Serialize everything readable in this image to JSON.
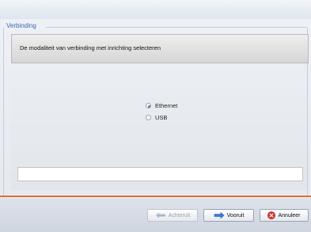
{
  "group": {
    "legend": "Verbinding"
  },
  "header": {
    "instruction": "De modaliteit van verbinding met inrichting selecteren"
  },
  "connection": {
    "options": [
      {
        "label": "Ethernet",
        "selected": true
      },
      {
        "label": "USB",
        "selected": false
      }
    ]
  },
  "footer": {
    "back_label": "Achteruit",
    "next_label": "Vooruit",
    "cancel_label": "Annuleer"
  },
  "colors": {
    "accent": "#e36b22",
    "legend": "#3a66b5",
    "next_arrow": "#3a7bd5",
    "cancel": "#d9302a"
  }
}
